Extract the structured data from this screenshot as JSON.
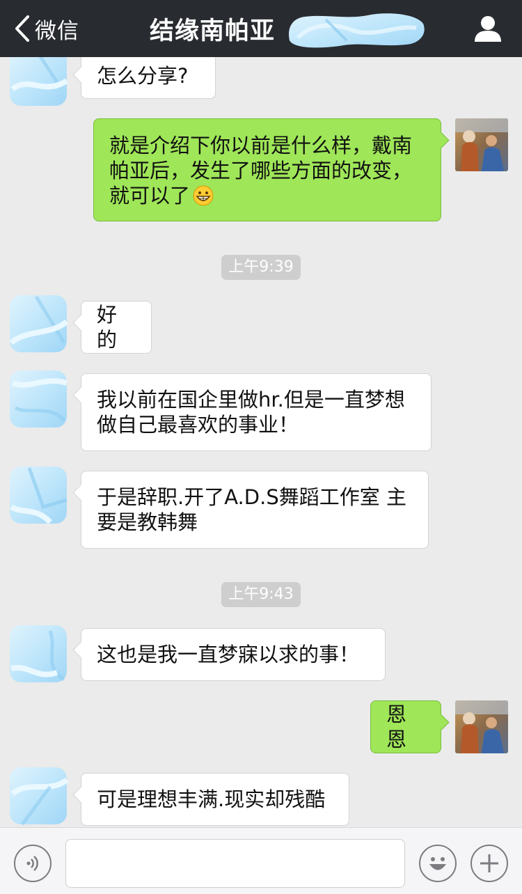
{
  "navbar": {
    "back_label": "微信",
    "title": "结缘南帕亚"
  },
  "messages": [
    {
      "side": "left",
      "text": "怎么分享?"
    },
    {
      "side": "right",
      "text": "就是介绍下你以前是什么样，戴南帕亚后，发生了哪些方面的改变，就可以了",
      "emoji": "grinning-face-emoji"
    },
    {
      "type": "time",
      "text": "上午9:39"
    },
    {
      "side": "left",
      "text": "好的"
    },
    {
      "side": "left",
      "text": "我以前在国企里做hr.但是一直梦想做自己最喜欢的事业！"
    },
    {
      "side": "left",
      "text": "于是辞职.开了A.D.S舞蹈工作室 主要是教韩舞"
    },
    {
      "type": "time",
      "text": "上午9:43"
    },
    {
      "side": "left",
      "text": "这也是我一直梦寐以求的事！"
    },
    {
      "side": "right",
      "text": "恩恩"
    },
    {
      "side": "left",
      "text": "可是理想丰满.现实却残酷"
    }
  ],
  "input_bar": {
    "voice_icon": "voice-icon",
    "emoji_icon": "emoji-icon",
    "plus_icon": "plus-icon",
    "text_value": ""
  },
  "colors": {
    "navbar_bg": "#282b30",
    "chat_bg": "#ebebeb",
    "sent_bubble": "#9fe658",
    "received_bubble": "#ffffff",
    "timestamp_bg": "#cecece"
  }
}
